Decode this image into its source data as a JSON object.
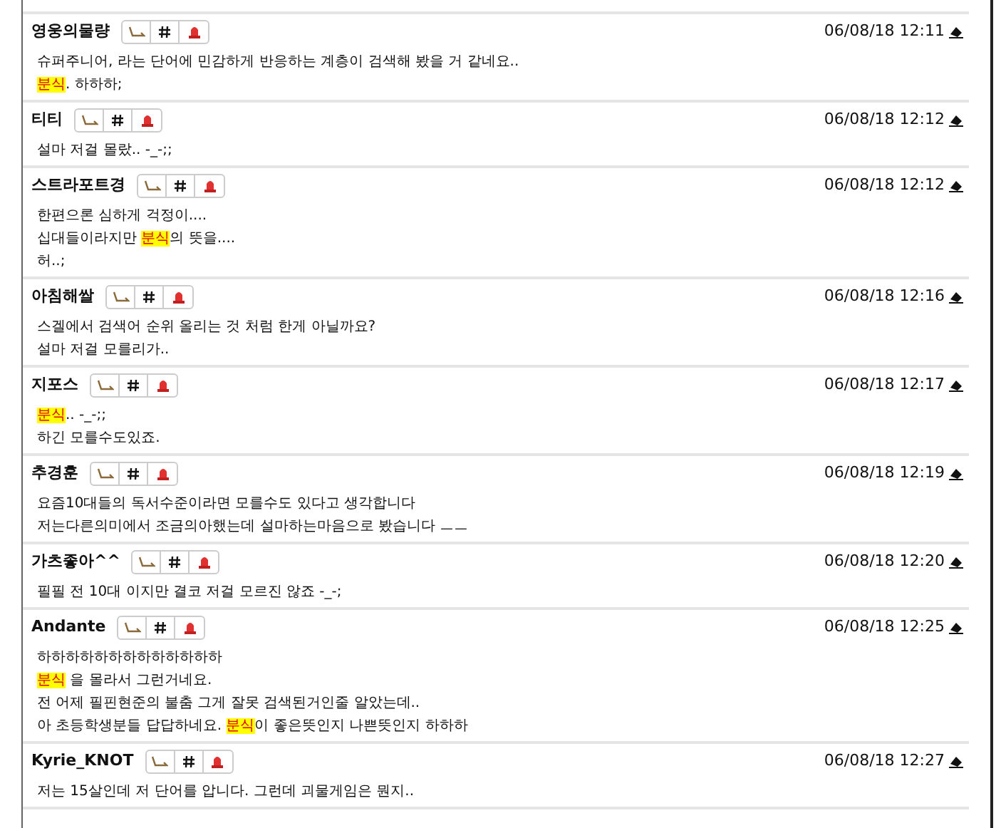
{
  "comments": [
    {
      "author": "영웅의물량",
      "time": "06/08/18 12:11",
      "lines": [
        [
          {
            "text": "슈퍼주니어, 라는 단어에 민감하게 반응하는 계층이 검색해 봤을 거 같네요.."
          }
        ],
        [
          {
            "text": "분식",
            "highlight": true
          },
          {
            "text": ". 하하하;"
          }
        ]
      ]
    },
    {
      "author": "티티",
      "time": "06/08/18 12:12",
      "lines": [
        [
          {
            "text": "설마 저걸 몰랐.. -_-;;"
          }
        ]
      ]
    },
    {
      "author": "스트라포트경",
      "time": "06/08/18 12:12",
      "lines": [
        [
          {
            "text": "한편으론 심하게 걱정이...."
          }
        ],
        [
          {
            "text": "십대들이라지만 "
          },
          {
            "text": "분식",
            "highlight": true
          },
          {
            "text": "의 뜻을...."
          }
        ],
        [
          {
            "text": "허..;"
          }
        ]
      ]
    },
    {
      "author": "아침해쌀",
      "time": "06/08/18 12:16",
      "lines": [
        [
          {
            "text": "스겔에서 검색어 순위 올리는 것 처럼 한게 아닐까요?"
          }
        ],
        [
          {
            "text": "설마 저걸 모를리가.."
          }
        ]
      ]
    },
    {
      "author": "지포스",
      "time": "06/08/18 12:17",
      "lines": [
        [
          {
            "text": "분식",
            "highlight": true
          },
          {
            "text": ".. -_-;;"
          }
        ],
        [
          {
            "text": "하긴 모를수도있죠."
          }
        ]
      ]
    },
    {
      "author": "추경훈",
      "time": "06/08/18 12:19",
      "lines": [
        [
          {
            "text": "요즘10대들의 독서수준이라면 모를수도 있다고 생각합니다"
          }
        ],
        [
          {
            "text": "저는다른의미에서 조금의아했는데 설마하는마음으로 봤습니다 ㅡㅡ"
          }
        ]
      ]
    },
    {
      "author": "가츠좋아^^",
      "time": "06/08/18 12:20",
      "lines": [
        [
          {
            "text": "필필 전 10대 이지만 결코 저걸 모르진 않죠 -_-;"
          }
        ]
      ]
    },
    {
      "author": "Andante",
      "time": "06/08/18 12:25",
      "lines": [
        [
          {
            "text": "하하하하하하하하하하하하하"
          }
        ],
        [
          {
            "text": "분식",
            "highlight": true
          },
          {
            "text": " 을 몰라서 그런거네요."
          }
        ],
        [
          {
            "text": "전 어제 필핀현준의 불춤 그게 잘못 검색된거인줄 알았는데.."
          }
        ],
        [
          {
            "text": "아 초등학생분들 답답하네요. "
          },
          {
            "text": "분식",
            "highlight": true
          },
          {
            "text": "이 좋은뜻인지 나쁜뜻인지 하하하"
          }
        ]
      ]
    },
    {
      "author": "Kyrie_KNOT",
      "time": "06/08/18 12:27",
      "lines": [
        [
          {
            "text": "저는 15살인데 저 단어를 압니다. 그런데 괴물게임은 뭔지.."
          }
        ]
      ]
    }
  ]
}
